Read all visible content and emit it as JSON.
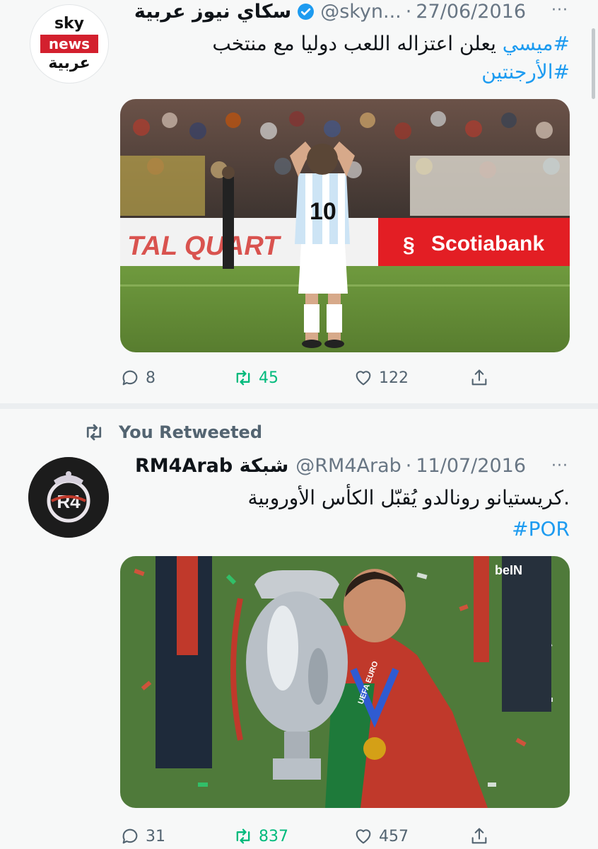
{
  "tweet1": {
    "avatar": {
      "line1": "sky",
      "line2": "news",
      "line3": "عربية"
    },
    "display_name": "سكاي نيوز عربية",
    "verified_icon": "verified-badge-icon",
    "handle": "@skyn...",
    "dot": "·",
    "date": "27/06/2016",
    "more": "···",
    "text_hashtag1": "#ميسي",
    "text_body": " يعلن اعتزاله اللعب دوليا مع منتخب ",
    "text_hashtag2": "#الأرجنتين",
    "image": {
      "banner_left": "TAL QUART",
      "banner_right": "Scotiabank",
      "shirt_number": "10"
    },
    "counts": {
      "replies": "8",
      "retweets": "45",
      "likes": "122"
    }
  },
  "tweet2": {
    "retweet_label": "You Retweeted",
    "display_name": "RM4Arab شبكة",
    "handle": "@RM4Arab",
    "dot": "·",
    "date": "11/07/2016",
    "more": "···",
    "text_body": ".كريستيانو رونالدو يُقبّل الكأس الأوروبية",
    "text_hashtag": "#POR",
    "image": {
      "channel_logo": "beIN",
      "medal_text": "UEFA EURO"
    },
    "counts": {
      "replies": "31",
      "retweets": "837",
      "likes": "457"
    }
  },
  "colors": {
    "accent": "#1d9bf0",
    "retweet_green": "#00ba7c",
    "muted": "#536471",
    "brand_red": "#d3202e"
  }
}
